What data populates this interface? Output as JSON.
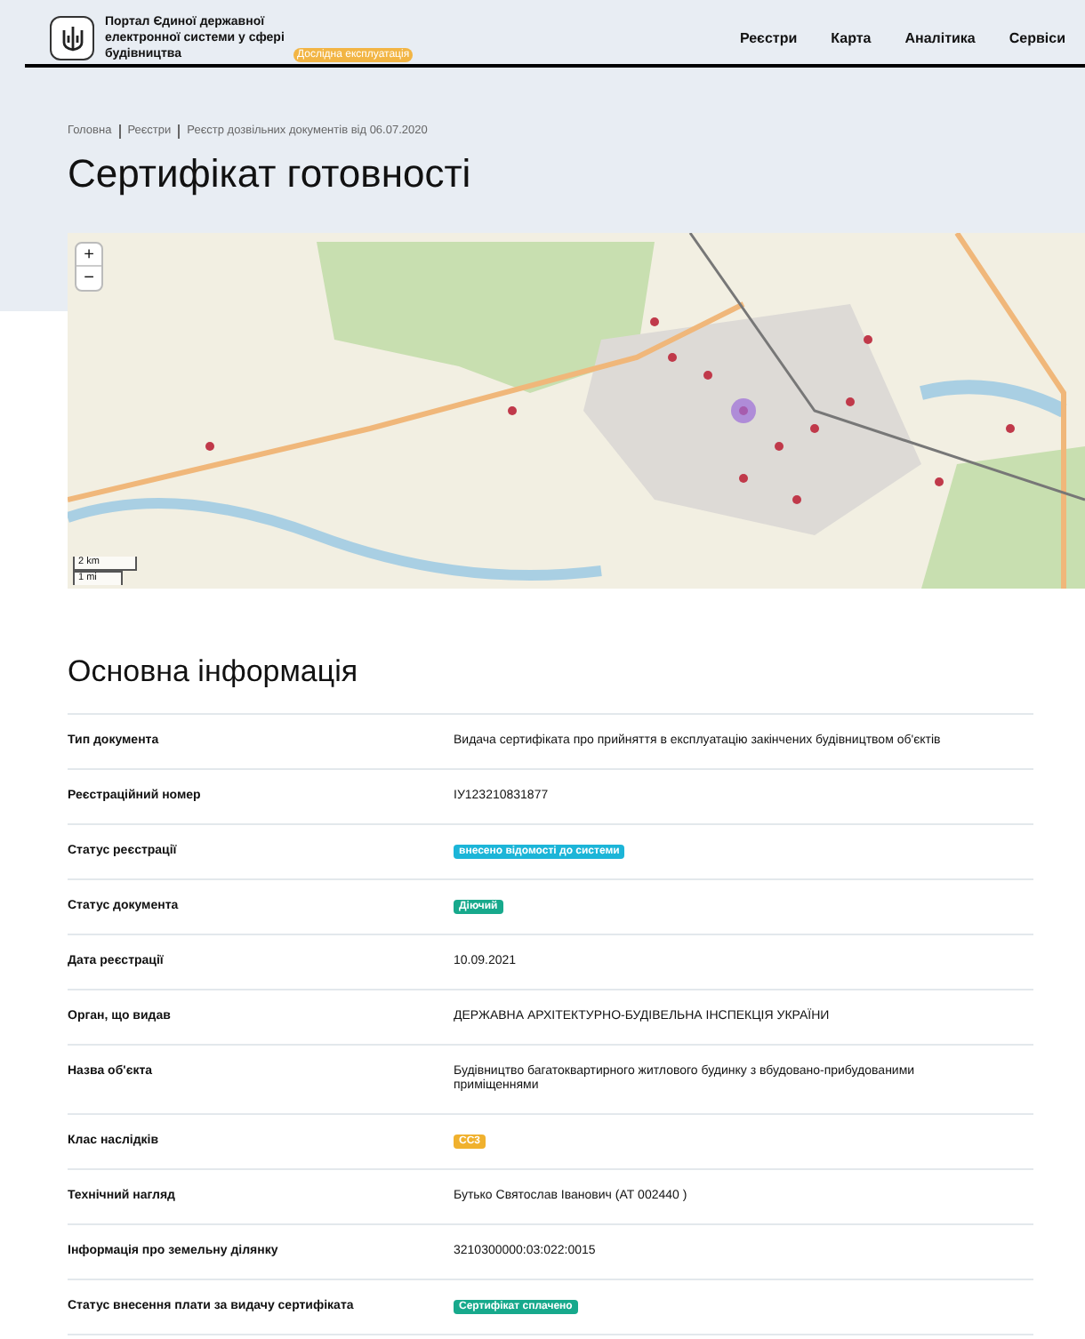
{
  "header": {
    "logo_text": "Портал Єдиної державної електронної системи у сфері будівництва",
    "badge": "Дослідна експлуатація",
    "nav": [
      "Реєстри",
      "Карта",
      "Аналітика",
      "Сервіси"
    ]
  },
  "breadcrumbs": [
    "Головна",
    "Реєстри",
    "Реєстр дозвільних документів від 06.07.2020"
  ],
  "title": "Сертифікат готовності",
  "map": {
    "zoom_in": "+",
    "zoom_out": "−",
    "scale": [
      "2 km",
      "1 mi"
    ]
  },
  "section_title": "Основна інформація",
  "rows": [
    {
      "label": "Тип документа",
      "kind": "text",
      "value": "Видача сертифіката про прийняття в експлуатацію закінчених будівництвом об'єктів"
    },
    {
      "label": "Реєстраційний номер",
      "kind": "text",
      "value": "ІУ123210831877"
    },
    {
      "label": "Статус реєстрації",
      "kind": "badge",
      "value": "внесено відомості до системи",
      "color": "#1cb5d8"
    },
    {
      "label": "Статус документа",
      "kind": "badge",
      "value": "Діючий",
      "color": "#17a98c"
    },
    {
      "label": "Дата реєстрації",
      "kind": "text",
      "value": "10.09.2021"
    },
    {
      "label": "Орган, що видав",
      "kind": "text",
      "value": "ДЕРЖАВНА АРХІТЕКТУРНО-БУДІВЕЛЬНА ІНСПЕКЦІЯ УКРАЇНИ"
    },
    {
      "label": "Назва об'єкта",
      "kind": "text",
      "value": "Будівництво багатоквартирного житлового будинку з вбудовано-прибудованими приміщеннями"
    },
    {
      "label": "Клас наслідків",
      "kind": "badge",
      "value": "СС3",
      "color": "#f0b12e"
    },
    {
      "label": "Технічний нагляд",
      "kind": "text",
      "value": "Бутько Святослав Іванович (АТ 002440 )"
    },
    {
      "label": "Інформація про земельну ділянку",
      "kind": "text",
      "value": "3210300000:03:022:0015"
    },
    {
      "label": "Статус внесення плати за видачу сертифіката",
      "kind": "badge",
      "value": "Сертифікат сплачено",
      "color": "#17a98c"
    }
  ]
}
